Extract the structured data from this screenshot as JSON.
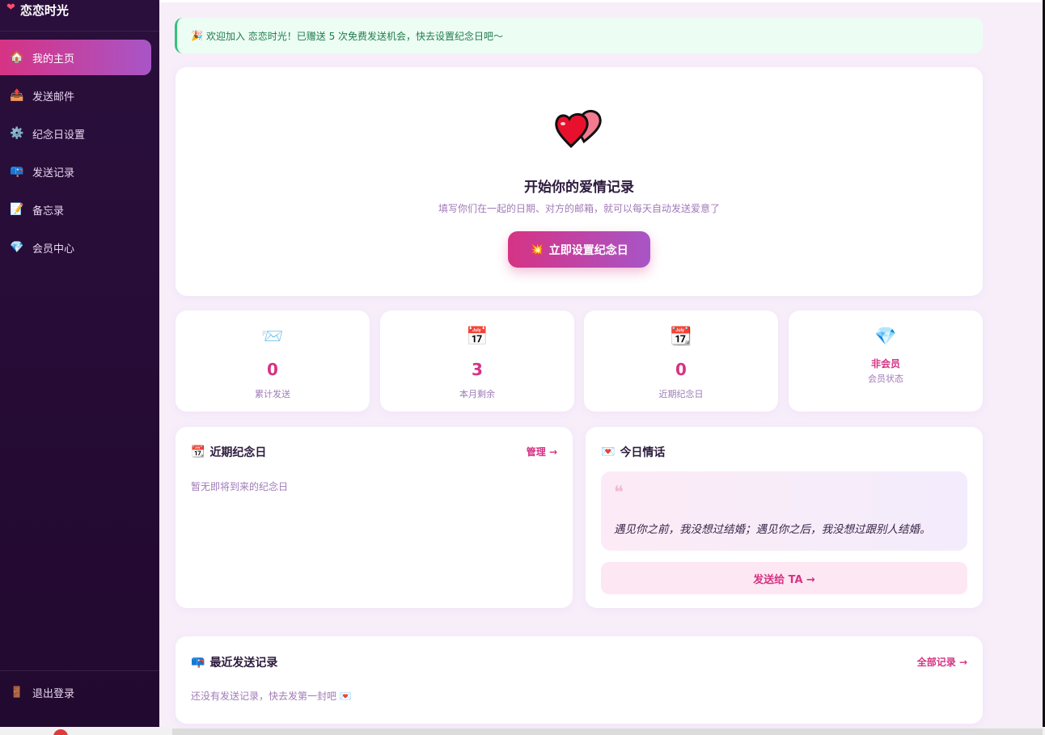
{
  "brand": {
    "name": "恋恋时光",
    "icon": "heart-icon"
  },
  "sidebar": {
    "items": [
      {
        "label": "我的主页",
        "icon": "🏠",
        "active": true
      },
      {
        "label": "发送邮件",
        "icon": "📤"
      },
      {
        "label": "纪念日设置",
        "icon": "⚙️"
      },
      {
        "label": "发送记录",
        "icon": "📪"
      },
      {
        "label": "备忘录",
        "icon": "📝"
      },
      {
        "label": "会员中心",
        "icon": "💎"
      }
    ],
    "logout": {
      "label": "退出登录",
      "icon": "🚪"
    }
  },
  "alert": {
    "icon": "🎉",
    "text": "欢迎加入 恋恋时光！已赠送 5 次免费发送机会，快去设置纪念日吧～"
  },
  "hero": {
    "title": "开始你的爱情记录",
    "subtitle": "填写你们在一起的日期、对方的邮箱，就可以每天自动发送爱意了",
    "cta_icon": "💥",
    "cta_label": "立即设置纪念日"
  },
  "stats": [
    {
      "icon": "📨",
      "value": "0",
      "label": "累计发送"
    },
    {
      "icon": "📅",
      "value": "3",
      "label": "本月剩余"
    },
    {
      "icon": "📆",
      "value": "0",
      "label": "近期纪念日"
    },
    {
      "icon": "💎",
      "value": "非会员",
      "label": "会员状态"
    }
  ],
  "upcoming": {
    "icon": "📆",
    "title": "近期纪念日",
    "link": "管理 →",
    "empty": "暂无即将到来的纪念日"
  },
  "today": {
    "icon": "💌",
    "title": "今日情话",
    "quote_mark": "❝",
    "quote": "遇见你之前，我没想过结婚；遇见你之后，我没想过跟别人结婚。",
    "send_label": "发送给 TA →"
  },
  "recent": {
    "icon": "📪",
    "title": "最近发送记录",
    "link": "全部记录 →",
    "empty": "还没有发送记录，快去发第一封吧",
    "empty_icon": "💌"
  },
  "colors": {
    "accent": "#d63384",
    "accent2": "#a855c7",
    "sidebar": "#2a0f3c"
  }
}
